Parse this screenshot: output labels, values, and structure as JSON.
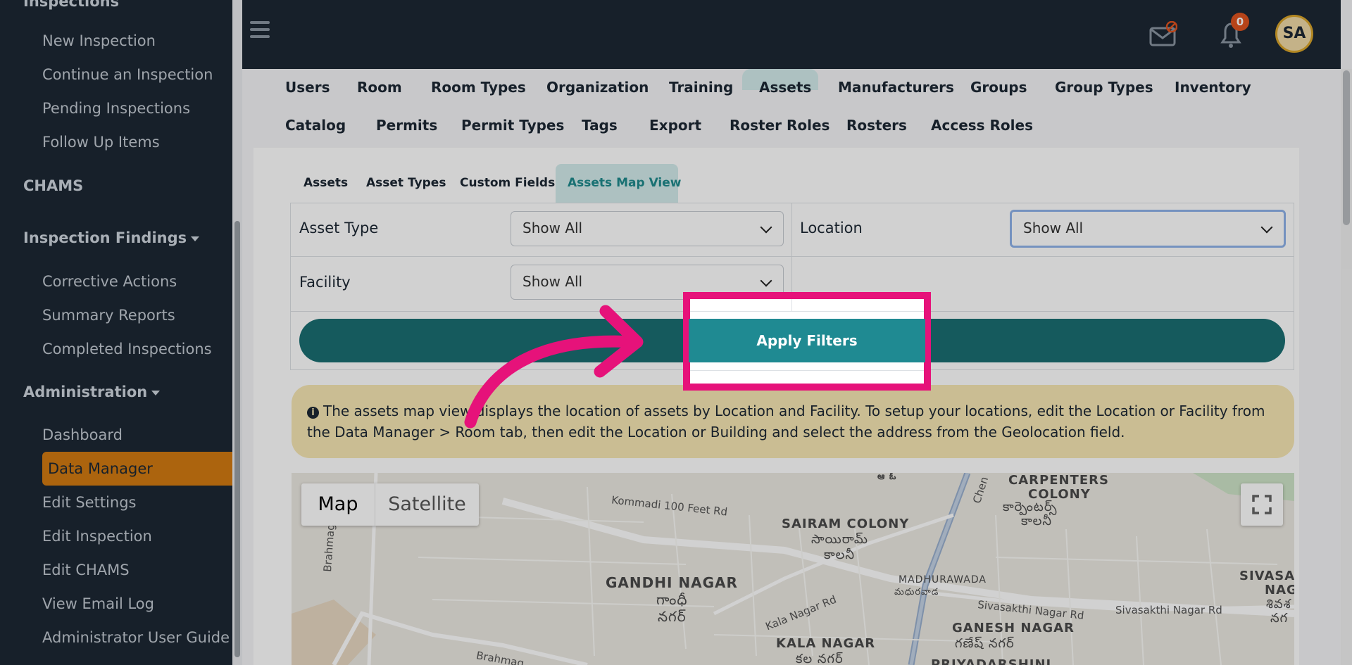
{
  "sidebar": {
    "partial_top": "Inspections",
    "items_top": [
      "New Inspection",
      "Continue an Inspection",
      "Pending Inspections",
      "Follow Up Items"
    ],
    "section_chams": "CHAMS",
    "section_findings": "Inspection Findings",
    "items_findings": [
      "Corrective Actions",
      "Summary Reports",
      "Completed Inspections"
    ],
    "section_admin": "Administration",
    "items_admin": [
      "Dashboard",
      "Data Manager",
      "Edit Settings",
      "Edit Inspection",
      "Edit CHAMS",
      "View Email Log",
      "Administrator User Guide"
    ]
  },
  "topbar": {
    "notification_count": "0",
    "avatar_initials": "SA"
  },
  "tabs_row1": [
    "Users",
    "Room",
    "Room Types",
    "Organization",
    "Training",
    "Assets",
    "Manufacturers",
    "Groups",
    "Group Types",
    "Inventory"
  ],
  "tabs_row2": [
    "Catalog",
    "Permits",
    "Permit Types",
    "Tags",
    "Export",
    "Roster Roles",
    "Rosters",
    "Access Roles"
  ],
  "subtabs": [
    "Assets",
    "Asset Types",
    "Custom Fields",
    "Assets Map View"
  ],
  "filters": {
    "asset_type_label": "Asset Type",
    "asset_type_value": "Show All",
    "location_label": "Location",
    "location_value": "Show All",
    "facility_label": "Facility",
    "facility_value": "Show All",
    "apply_label": "Apply Filters"
  },
  "info": {
    "line1": "The assets map view displays the location of assets by Location and Facility. To setup your locations, edit the Location or Facility from",
    "line2": "the Data Manager > Room tab, then edit the Location or Building and select the address from the Geolocation field."
  },
  "map": {
    "map_button": "Map",
    "satellite_button": "Satellite",
    "labels": {
      "carpenters_en": "CARPENTERS",
      "colony_en": "COLONY",
      "carpenters_te": "కార్పెంటర్స్",
      "colony_te": "కాలనీ",
      "sairam_en": "SAIRAM COLONY",
      "sairam_te1": "సాయిరామ్",
      "sairam_te2": "కాలనీ",
      "gandhi_en": "GANDHI NAGAR",
      "gandhi_te1": "గాంధీ",
      "gandhi_te2": "నగర్",
      "madhurawada_en": "MADHURAWADA",
      "madhurawada_te": "మధురవాడ",
      "ganesh_en": "GANESH NAGAR",
      "ganesh_te": "గణేష్ నగర్",
      "kala_en": "KALA NAGAR",
      "kala_te": "కల నగర్",
      "priyadarshini": "PRIYADARSHINI",
      "sivasa": "SIVASA",
      "naga": "NAGA",
      "siva_te": "శివశ",
      "naga_te": "నగ",
      "road1": "Kommadi 100 Feet Rd",
      "road2": "Kala Nagar Rd",
      "road3": "Sivasakthi Nagar Rd",
      "road4": "Sivasakthi Nagar Rd",
      "road5": "Brahmagupta R",
      "road6": "Brahmag",
      "road7": "Chen"
    }
  },
  "colors": {
    "sidebar_bg": "#1d2834",
    "active_item": "#d27b12",
    "primary_button": "#1a6e72",
    "highlight_border": "#e6127a",
    "info_bg": "#f7e7b4"
  }
}
